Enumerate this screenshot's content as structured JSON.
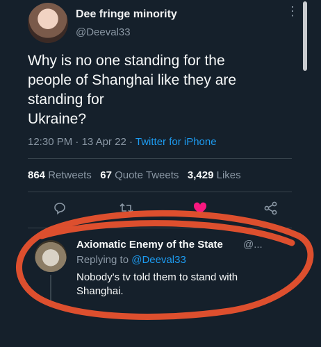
{
  "tweet": {
    "author_name": "Dee fringe minority",
    "author_handle": "@Deeval33",
    "text_lines": [
      "Why is no one standing for the",
      "people of Shanghai like they are",
      "standing for",
      "Ukraine?"
    ],
    "time": "12:30 PM",
    "date": "13 Apr 22",
    "separator": "·",
    "source": "Twitter for iPhone",
    "retweets_count": "864",
    "retweets_label": "Retweets",
    "quotes_count": "67",
    "quotes_label": "Quote Tweets",
    "likes_count": "3,429",
    "likes_label": "Likes"
  },
  "reply": {
    "author_name": "Axiomatic Enemy of the State",
    "author_handle": "@...",
    "replying_label": "Replying to",
    "replying_handle": "@Deeval33",
    "text_lines": [
      "Nobody's tv told them to stand with",
      "Shanghai."
    ]
  },
  "icons": {
    "reply": "reply-icon",
    "retweet": "retweet-icon",
    "like": "heart-icon",
    "share": "share-icon",
    "more": "more-icon"
  },
  "colors": {
    "background": "#15202b",
    "accent": "#1d9bf0",
    "like": "#f91880",
    "annotation": "#e8522e"
  }
}
